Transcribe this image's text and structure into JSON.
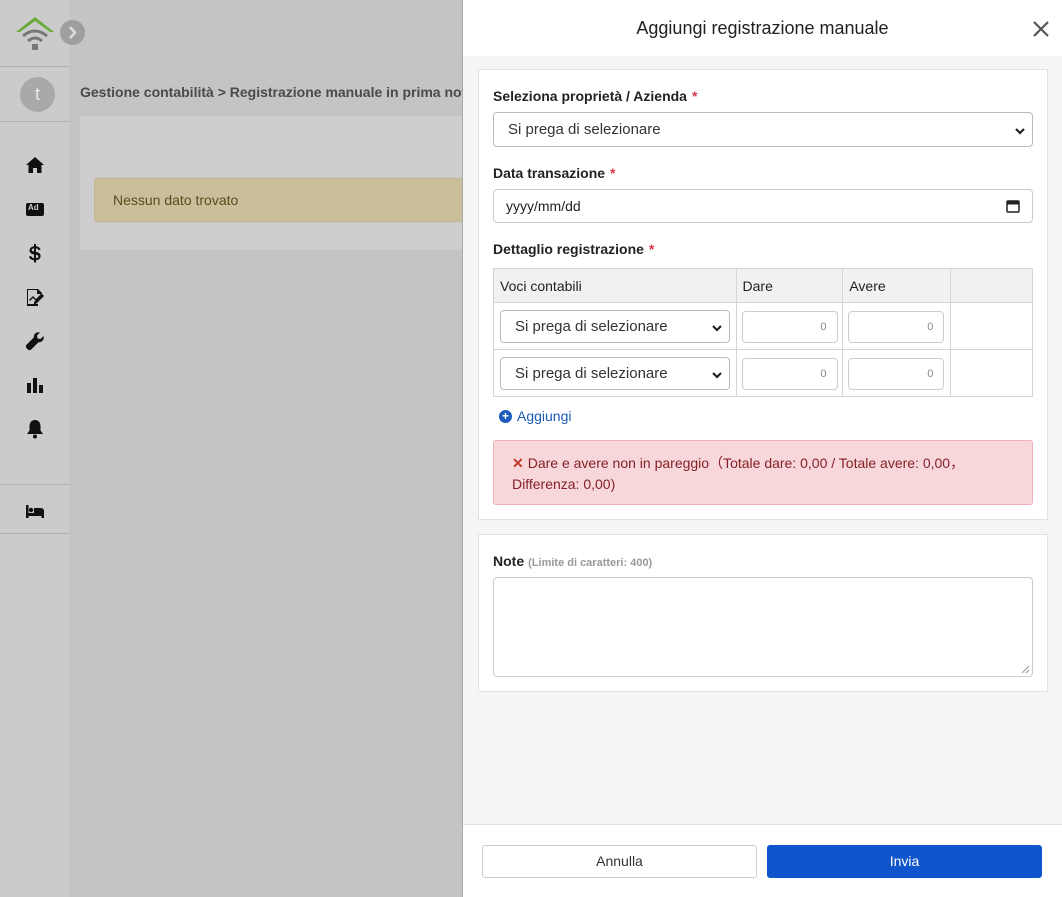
{
  "app": {
    "avatar_letter": "t",
    "breadcrumb": "Gestione contabilità > Registrazione manuale in prima nota",
    "empty_message": "Nessun dato trovato"
  },
  "sidebar": {
    "icons": [
      "home-icon",
      "ad-icon",
      "dollar-icon",
      "chart-document-icon",
      "wrench-icon",
      "bar-chart-icon",
      "bell-icon",
      "bed-icon"
    ],
    "ad_label": "Ad"
  },
  "modal": {
    "title": "Aggiungi registrazione manuale",
    "property_label": "Seleziona proprietà / Azienda",
    "property_value": "Si prega di selezionare",
    "date_label": "Data transazione",
    "date_placeholder": "yyyy/mm/dd",
    "detail_label": "Dettaglio registrazione",
    "required_mark": "*",
    "table": {
      "headers": [
        "Voci contabili",
        "Dare",
        "Avere"
      ],
      "rows": [
        {
          "account": "Si prega di selezionare",
          "dare": "0",
          "avere": "0"
        },
        {
          "account": "Si prega di selezionare",
          "dare": "0",
          "avere": "0"
        }
      ]
    },
    "add_label": "Aggiungi",
    "error_line1": "Dare e avere non in pareggio（Totale dare: 0,00 / Totale avere: 0,00，",
    "error_line2": "Differenza: 0,00)",
    "error_mark": "✕",
    "notes_label": "Note",
    "notes_hint": "(Limite di caratteri: 400)",
    "cancel_label": "Annulla",
    "submit_label": "Invia"
  },
  "colors": {
    "primary": "#1155cc",
    "error_bg": "#f8d7da",
    "required": "#d9364a",
    "logo_green": "#6aaa3a"
  }
}
